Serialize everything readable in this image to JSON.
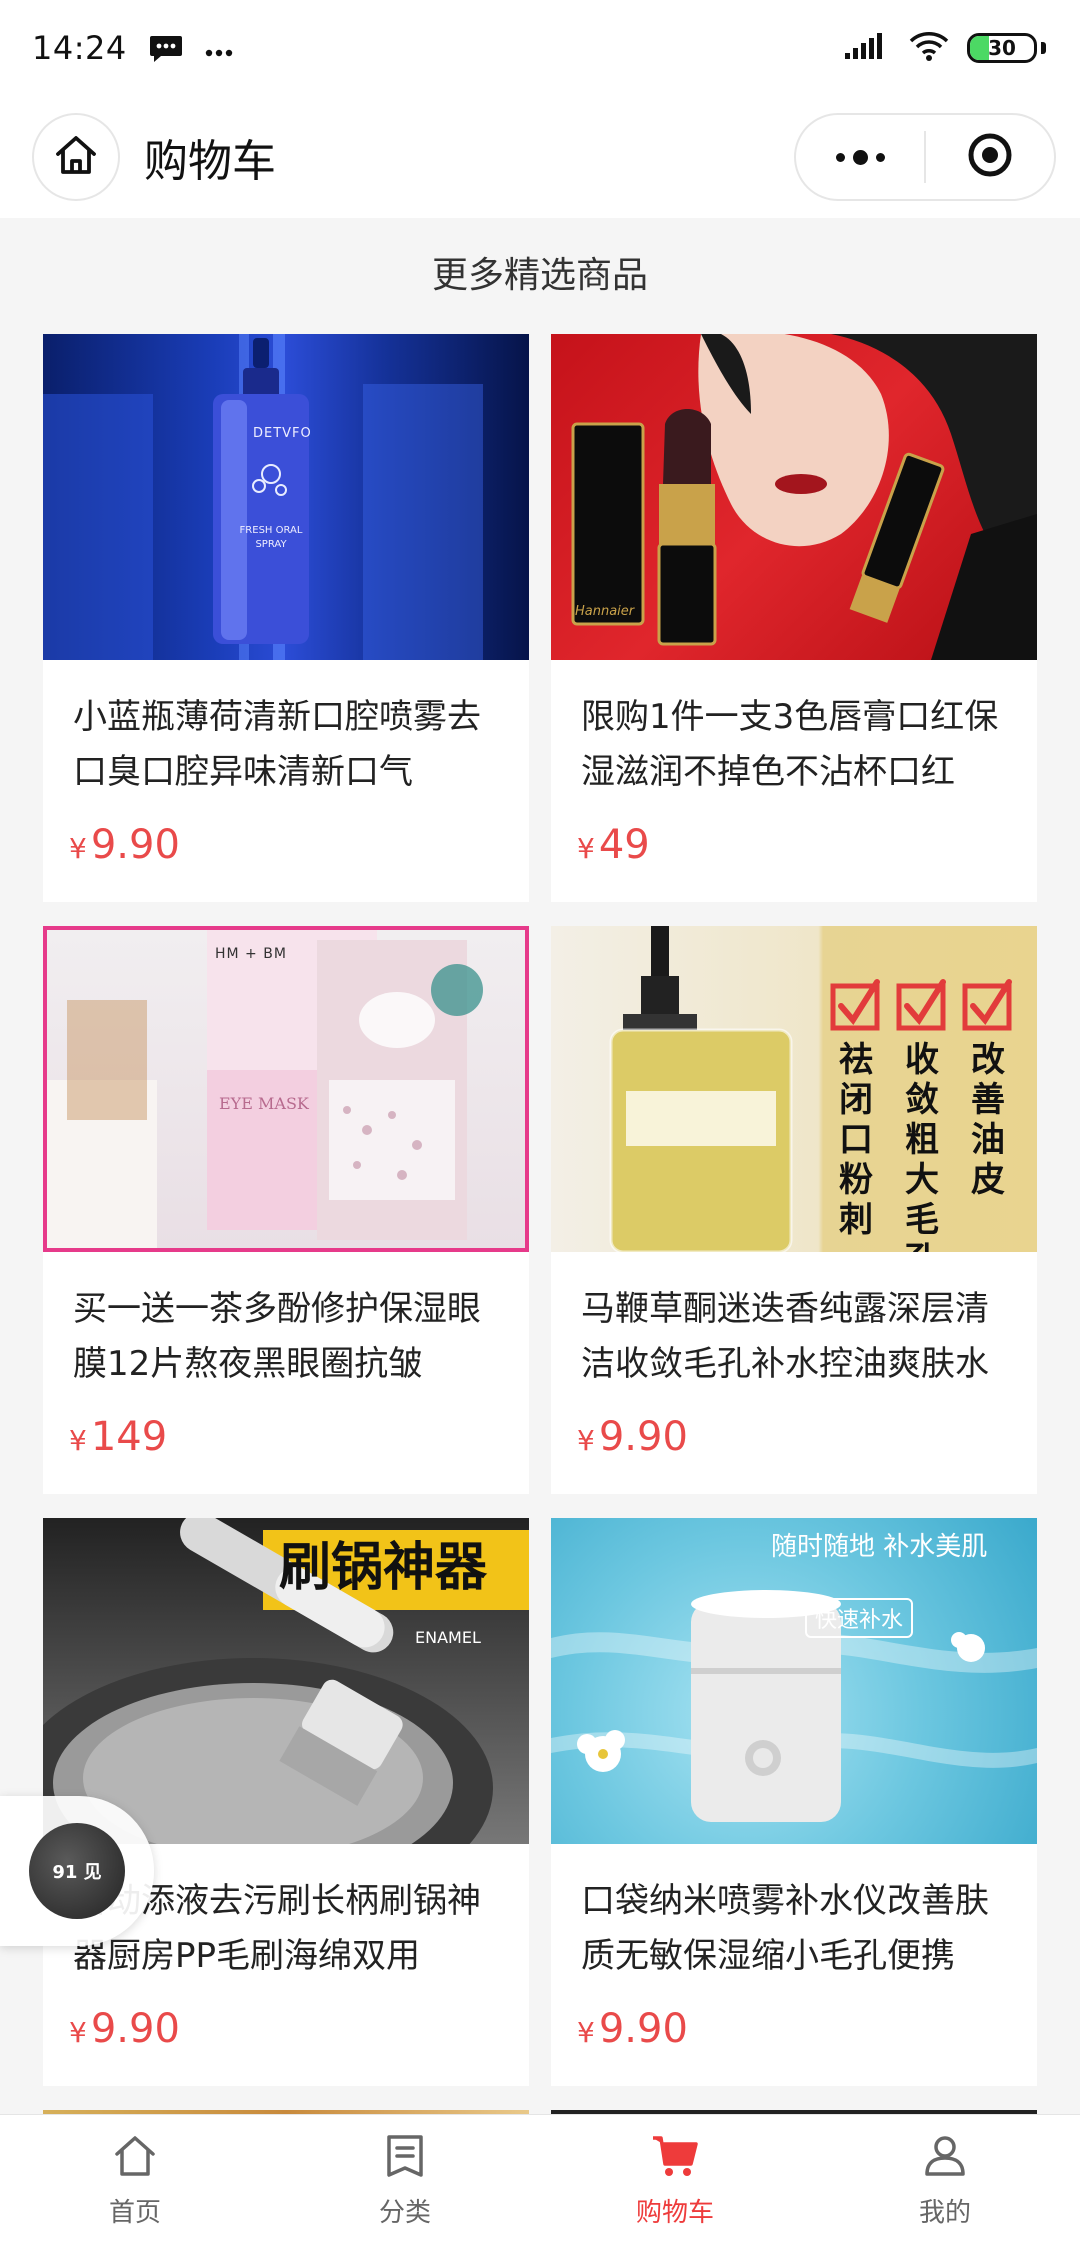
{
  "status_bar": {
    "time": "14:24",
    "battery": "30",
    "battery_level": 0.3,
    "icons": [
      "message-icon",
      "more-dots-icon",
      "signal-icon",
      "wifi-icon",
      "battery-icon"
    ]
  },
  "nav": {
    "title": "购物车",
    "icons": [
      "home-icon",
      "menu-dots-icon",
      "close-target-icon"
    ]
  },
  "section": {
    "title": "更多精选商品"
  },
  "products": [
    {
      "name": "小蓝瓶薄荷清新口腔喷雾去口臭口腔异味清新口气",
      "currency": "¥",
      "price": "9.90"
    },
    {
      "name": "限购1件一支3色唇膏口红保湿滋润不掉色不沾杯口红",
      "currency": "¥",
      "price": "49"
    },
    {
      "name": "买一送一茶多酚修护保湿眼膜12片熬夜黑眼圈抗皱",
      "currency": "¥",
      "price": "149"
    },
    {
      "name": "马鞭草酮迷迭香纯露深层清洁收敛毛孔补水控油爽肤水",
      "currency": "¥",
      "price": "9.90"
    },
    {
      "name": "自动添液去污刷长柄刷锅神器厨房PP毛刷海绵双用",
      "currency": "¥",
      "price": "9.90"
    },
    {
      "name": "口袋纳米喷雾补水仪改善肤质无敏保湿缩小毛孔便携",
      "currency": "¥",
      "price": "9.90"
    }
  ],
  "image_text": {
    "p1_brand": "DETVFO",
    "p1_label": "FRESH ORAL SPRAY",
    "p2_brand": "Hannaier",
    "p3_brand": "HM + BM",
    "p3_label": "EYE MASK",
    "p4_col1": "祛闭口粉刺",
    "p4_col2": "收敛粗大毛孔",
    "p4_col3": "改善油皮",
    "p5_title": "刷锅神器",
    "p5_label": "ENAMEL",
    "p6_title": "随时随地 补水美肌",
    "p6_badge": "快速补水"
  },
  "float_widget": {
    "label": "91 见"
  },
  "tabs": [
    {
      "label": "首页",
      "icon": "home-tab-icon",
      "active": false
    },
    {
      "label": "分类",
      "icon": "category-tab-icon",
      "active": false
    },
    {
      "label": "购物车",
      "icon": "cart-tab-icon",
      "active": true
    },
    {
      "label": "我的",
      "icon": "profile-tab-icon",
      "active": false
    }
  ],
  "colors": {
    "price": "#e94a4a",
    "active_tab": "#ee3b3b",
    "background": "#f5f5f5"
  }
}
